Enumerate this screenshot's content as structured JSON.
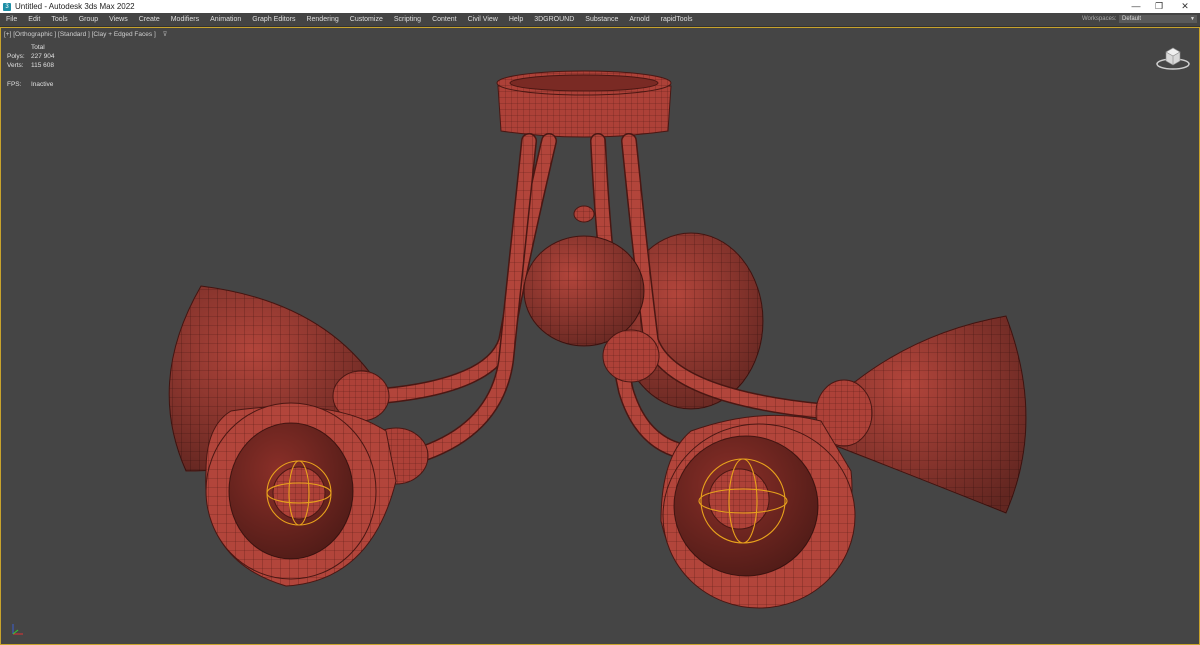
{
  "window": {
    "title": "Untitled - Autodesk 3ds Max 2022",
    "minimize": "—",
    "maximize": "❐",
    "close": "✕"
  },
  "menu": {
    "items": [
      "File",
      "Edit",
      "Tools",
      "Group",
      "Views",
      "Create",
      "Modifiers",
      "Animation",
      "Graph Editors",
      "Rendering",
      "Customize",
      "Scripting",
      "Content",
      "Civil View",
      "Help",
      "3DGROUND",
      "Substance",
      "Arnold",
      "rapidTools"
    ],
    "workspaces_label": "Workspaces:",
    "workspace_value": "Default"
  },
  "viewport": {
    "label": "[+] [Orthographic ] [Standard ] [Clay + Edged Faces ]",
    "stats": {
      "total_label": "Total",
      "polys_label": "Polys:",
      "polys_value": "227 904",
      "verts_label": "Verts:",
      "verts_value": "115 608",
      "fps_label": "FPS:",
      "fps_value": "Inactive"
    }
  },
  "colors": {
    "background": "#454545",
    "clay": "#b2453b",
    "wire": "#5a1d18",
    "selection": "#e8a21c",
    "viewport_border": "#c8a32c"
  },
  "icons": [
    "app-icon",
    "filter-icon",
    "viewcube-icon",
    "axis-tripod-icon"
  ]
}
